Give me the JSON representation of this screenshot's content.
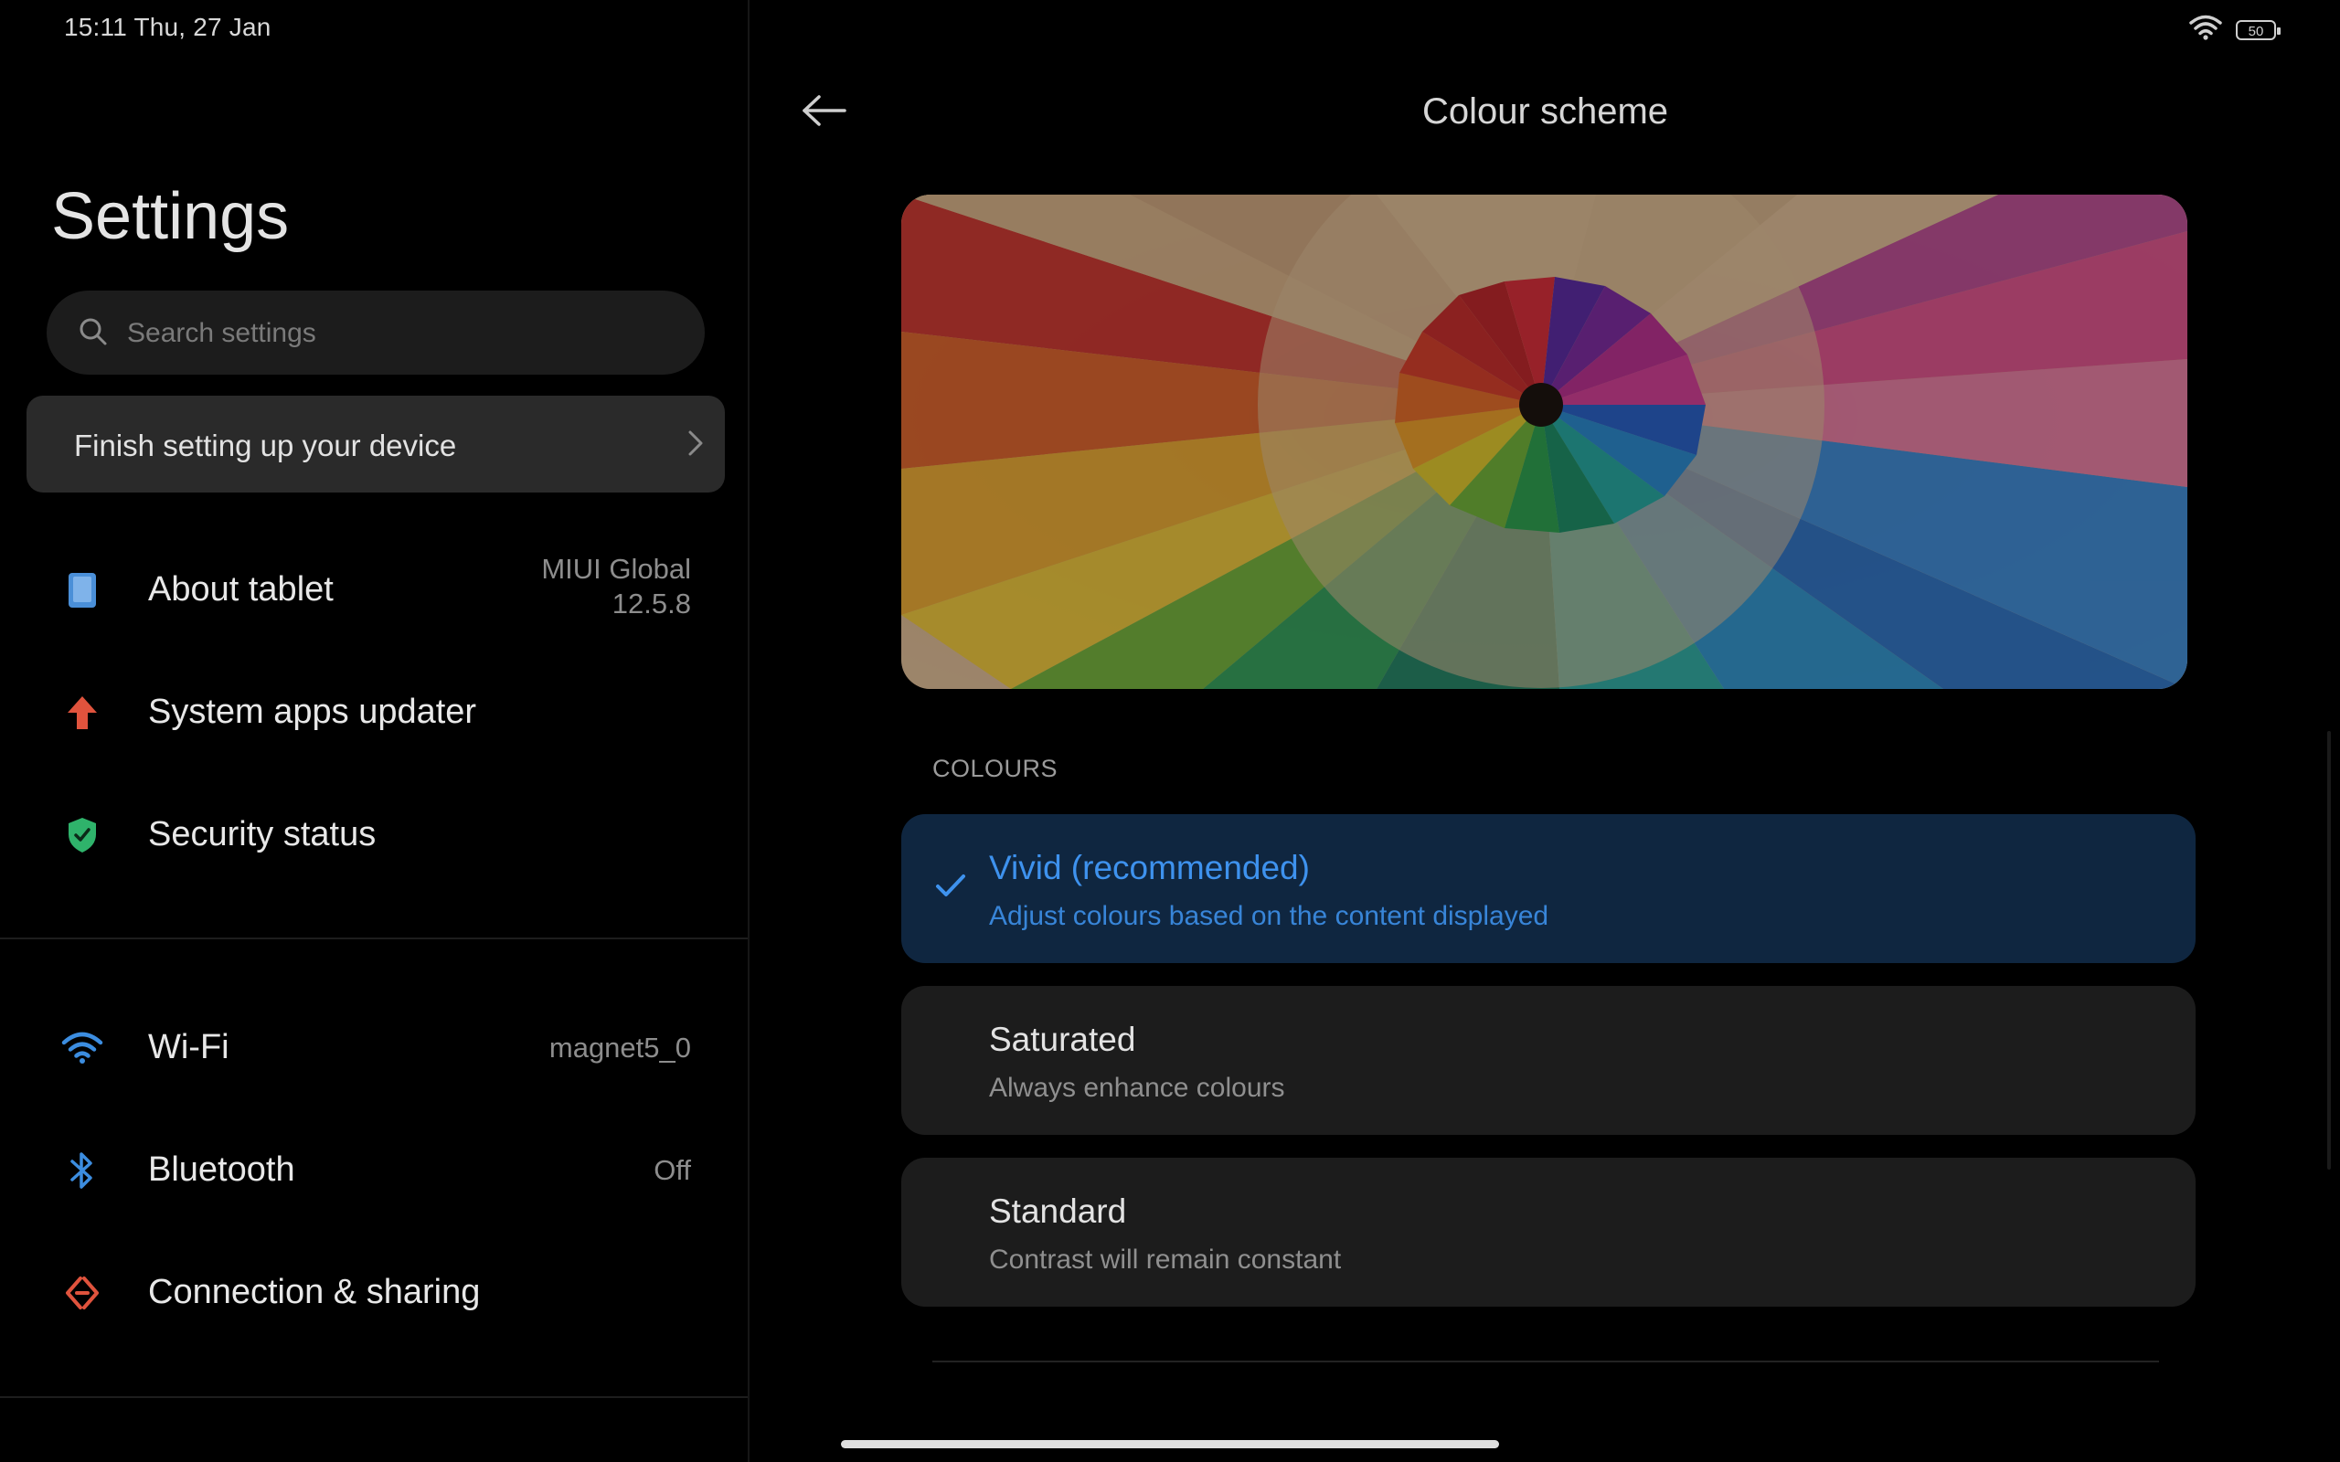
{
  "status_bar": {
    "time_date": "15:11  Thu, 27 Jan",
    "battery": "50"
  },
  "left": {
    "title": "Settings",
    "search_placeholder": "Search settings",
    "finish_setup": "Finish setting up your device",
    "items": [
      {
        "label": "About tablet",
        "value_line1": "MIUI Global",
        "value_line2": "12.5.8",
        "icon": "tablet-icon"
      },
      {
        "label": "System apps updater",
        "icon": "update-arrow-icon"
      },
      {
        "label": "Security status",
        "icon": "shield-check-icon"
      },
      {
        "label": "Wi-Fi",
        "value": "magnet5_0",
        "icon": "wifi-icon"
      },
      {
        "label": "Bluetooth",
        "value": "Off",
        "icon": "bluetooth-icon"
      },
      {
        "label": "Connection & sharing",
        "icon": "connection-sharing-icon"
      }
    ]
  },
  "right": {
    "title": "Colour scheme",
    "section_label": "COLOURS",
    "options": [
      {
        "title": "Vivid (recommended)",
        "subtitle": "Adjust colours based on the content displayed",
        "selected": true
      },
      {
        "title": "Saturated",
        "subtitle": "Always enhance colours",
        "selected": false
      },
      {
        "title": "Standard",
        "subtitle": "Contrast will remain constant",
        "selected": false
      }
    ]
  },
  "colors": {
    "accent": "#3e92ee",
    "selected_bg": "#0f2640",
    "card_bg": "#1c1c1c",
    "security_green": "#2fb36b",
    "updater_red": "#e0533d",
    "about_blue": "#4a8fd8"
  }
}
